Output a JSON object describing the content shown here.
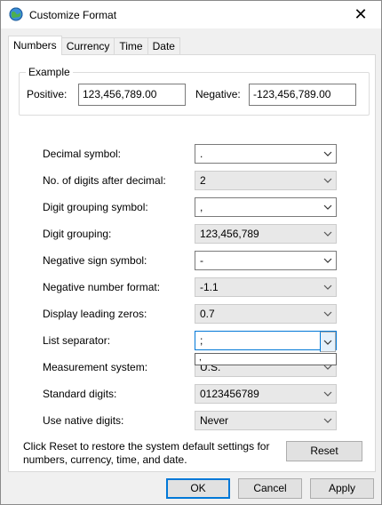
{
  "window": {
    "title": "Customize Format",
    "close_label": "✕",
    "app_icon": "globe-icon"
  },
  "tabs": [
    {
      "label": "Numbers",
      "active": true
    },
    {
      "label": "Currency",
      "active": false
    },
    {
      "label": "Time",
      "active": false
    },
    {
      "label": "Date",
      "active": false
    }
  ],
  "example": {
    "legend": "Example",
    "positive_label": "Positive:",
    "positive_value": "123,456,789.00",
    "negative_label": "Negative:",
    "negative_value": "-123,456,789.00"
  },
  "settings": [
    {
      "label": "Decimal symbol:",
      "value": ".",
      "disabled": false
    },
    {
      "label": "No. of digits after decimal:",
      "value": "2",
      "disabled": true
    },
    {
      "label": "Digit grouping symbol:",
      "value": ",",
      "disabled": false
    },
    {
      "label": "Digit grouping:",
      "value": "123,456,789",
      "disabled": true
    },
    {
      "label": "Negative sign symbol:",
      "value": "-",
      "disabled": false
    },
    {
      "label": "Negative number format:",
      "value": "-1.1",
      "disabled": true
    },
    {
      "label": "Display leading zeros:",
      "value": "0.7",
      "disabled": true
    },
    {
      "label": "List separator:",
      "value": ";",
      "disabled": false,
      "focused": true
    },
    {
      "label": "Measurement system:",
      "value": "U.S.",
      "disabled": true
    },
    {
      "label": "Standard digits:",
      "value": "0123456789",
      "disabled": true
    },
    {
      "label": "Use native digits:",
      "value": "Never",
      "disabled": true
    }
  ],
  "list_separator_dropdown": {
    "options": [
      ","
    ]
  },
  "reset": {
    "description": "Click Reset to restore the system default settings for numbers, currency, time, and date.",
    "button_label": "Reset"
  },
  "footer": {
    "ok_label": "OK",
    "cancel_label": "Cancel",
    "apply_label": "Apply"
  },
  "colors": {
    "accent": "#0078d7",
    "disabled_field": "#e8e8e8",
    "dialog_bg": "#f0f0f0"
  }
}
